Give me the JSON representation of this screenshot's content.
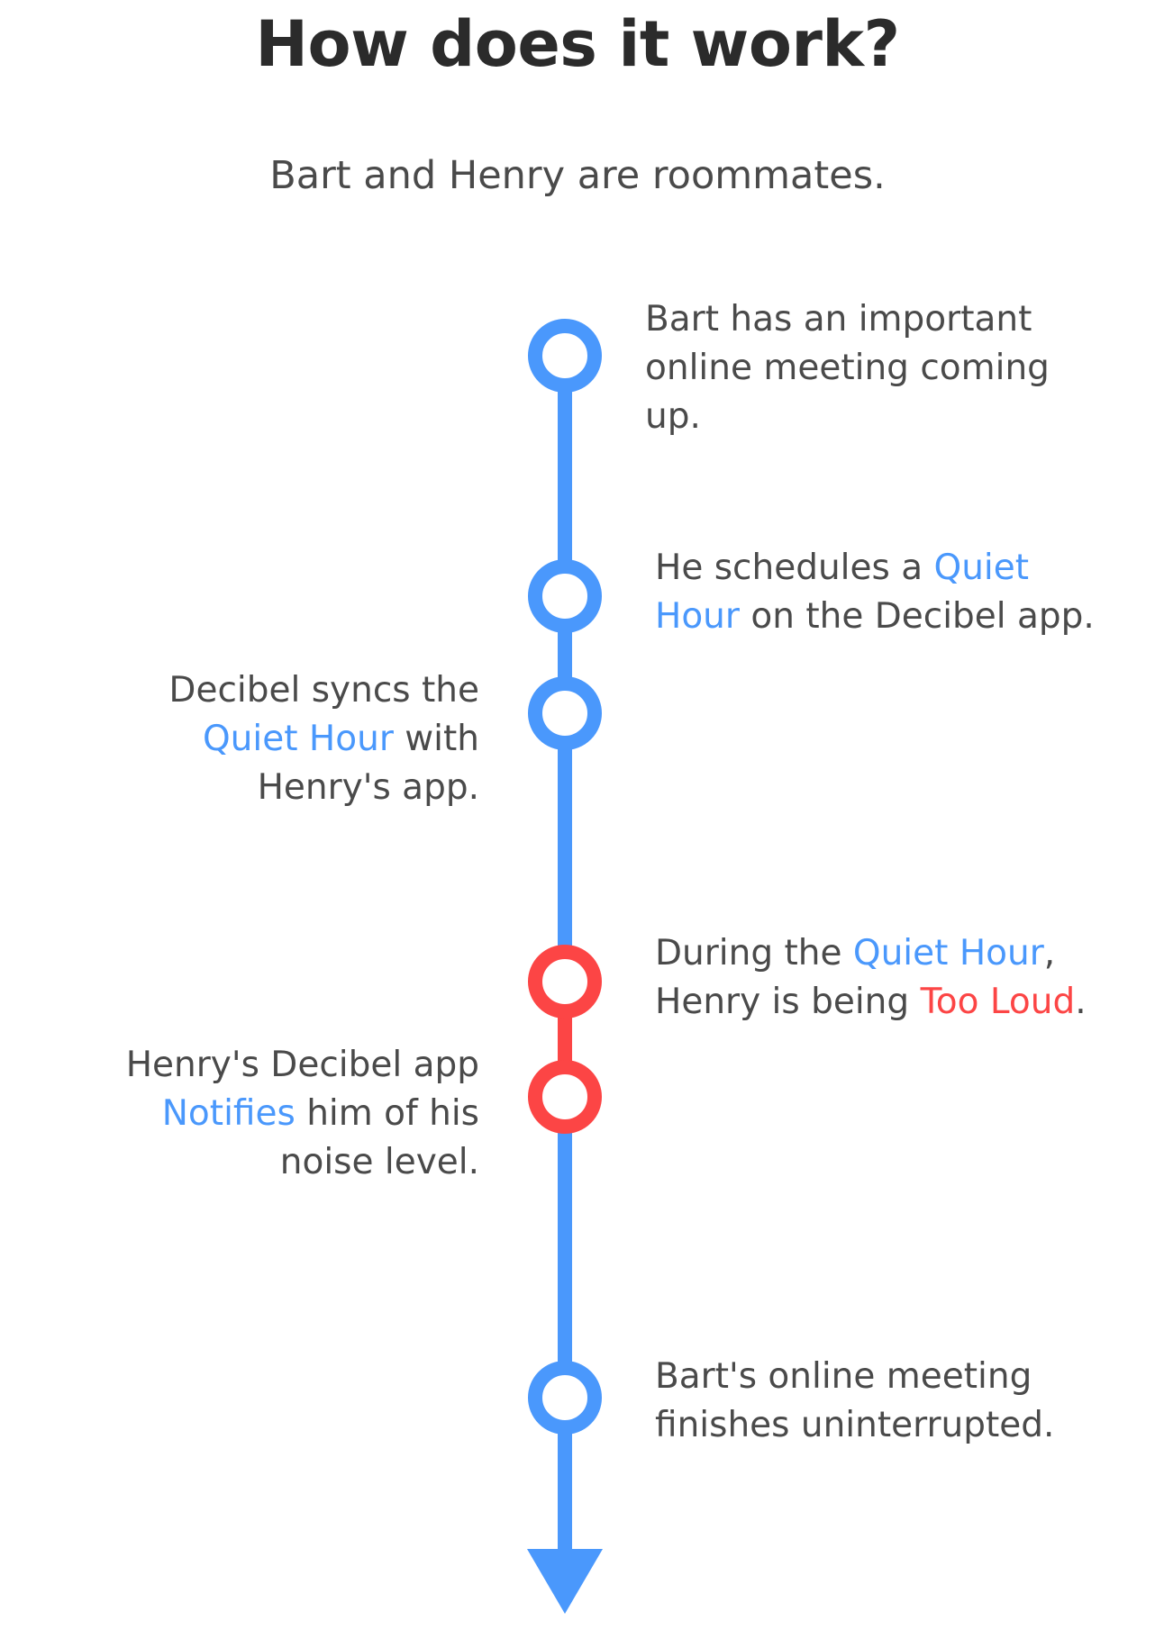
{
  "header": {
    "title": "How does it work?",
    "subtitle": "Bart and Henry are roommates."
  },
  "colors": {
    "blue": "#4a98fc",
    "red": "#fc4545",
    "text": "#4a4a4a",
    "title": "#2b2b2b"
  },
  "steps": [
    {
      "side": "right",
      "color": "blue",
      "segments": [
        {
          "text": "Bart has an important online meeting coming up."
        }
      ]
    },
    {
      "side": "right",
      "color": "blue",
      "segments": [
        {
          "text": "He schedules a "
        },
        {
          "text": "Quiet Hour",
          "hl": "blue"
        },
        {
          "text": " on the Decibel app."
        }
      ]
    },
    {
      "side": "left",
      "color": "blue",
      "segments": [
        {
          "text": "Decibel syncs the "
        },
        {
          "text": "Quiet Hour",
          "hl": "blue"
        },
        {
          "text": " with Henry's app."
        }
      ]
    },
    {
      "side": "right",
      "color": "red",
      "segments": [
        {
          "text": "During the "
        },
        {
          "text": "Quiet Hour",
          "hl": "blue"
        },
        {
          "text": ", Henry is being "
        },
        {
          "text": "Too Loud",
          "hl": "red"
        },
        {
          "text": "."
        }
      ]
    },
    {
      "side": "left",
      "color": "red",
      "segments": [
        {
          "text": "Henry's Decibel app "
        },
        {
          "text": "Notifies",
          "hl": "blue"
        },
        {
          "text": " him of his noise level."
        }
      ]
    },
    {
      "side": "right",
      "color": "blue",
      "segments": [
        {
          "text": "Bart's online meeting finishes uninterrupted."
        }
      ]
    }
  ]
}
